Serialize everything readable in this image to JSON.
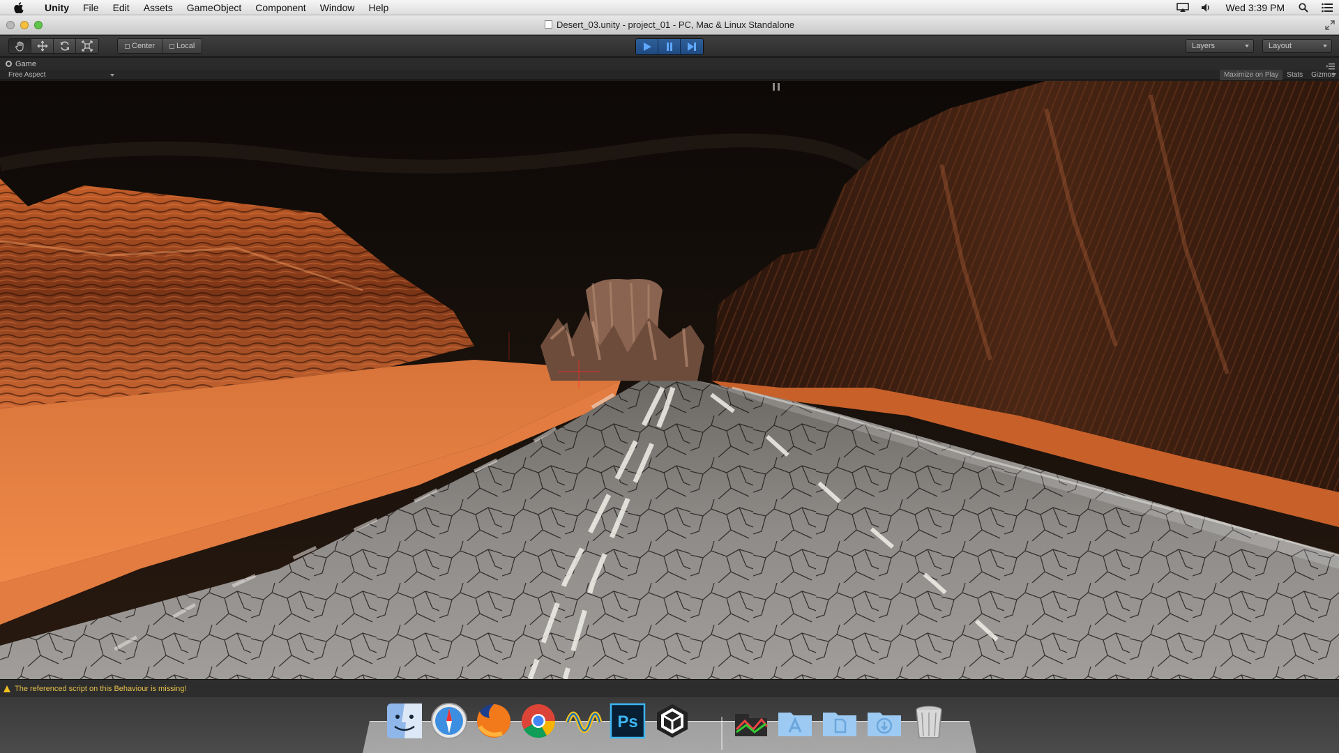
{
  "menubar": {
    "app_name": "Unity",
    "items": [
      "File",
      "Edit",
      "Assets",
      "GameObject",
      "Component",
      "Window",
      "Help"
    ],
    "clock": "Wed 3:39 PM"
  },
  "window": {
    "title": "Desert_03.unity - project_01 - PC, Mac & Linux Standalone"
  },
  "toolbar": {
    "transform_tools": [
      "hand-tool",
      "move-tool",
      "rotate-tool",
      "scale-tool"
    ],
    "pivot_label": "Center",
    "space_label": "Local",
    "layers_label": "Layers",
    "layout_label": "Layout",
    "accent_color": "#2f6fb8"
  },
  "game_view": {
    "tab_label": "Game",
    "aspect_label": "Free Aspect",
    "maximize_label": "Maximize on Play",
    "stats_label": "Stats",
    "gizmos_label": "Gizmos"
  },
  "status": {
    "message": "The referenced script on this Behaviour is missing!",
    "color": "#e7c14c"
  },
  "dock": {
    "apps": [
      "finder",
      "safari",
      "firefox",
      "chrome",
      "wireshark-like-app",
      "photoshop",
      "unity",
      "downloads-stack",
      "applications-folder",
      "documents-folder",
      "downloads-folder",
      "trash"
    ],
    "photoshop_label": "Ps"
  }
}
